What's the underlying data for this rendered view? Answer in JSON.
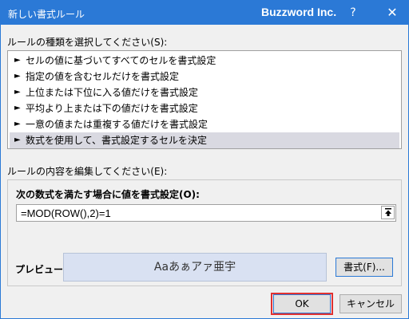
{
  "window": {
    "title": "新しい書式ルール",
    "brand": "Buzzword Inc.",
    "help_label": "?",
    "close_label": "✕"
  },
  "rule_type": {
    "label": "ルールの種類を選択してください(S):",
    "items": [
      {
        "label": "セルの値に基づいてすべてのセルを書式設定"
      },
      {
        "label": "指定の値を含むセルだけを書式設定"
      },
      {
        "label": "上位または下位に入る値だけを書式設定"
      },
      {
        "label": "平均より上または下の値だけを書式設定"
      },
      {
        "label": "一意の値または重複する値だけを書式設定"
      },
      {
        "label": "数式を使用して、書式設定するセルを決定"
      }
    ],
    "selected_index": 5
  },
  "rule_desc": {
    "label": "ルールの内容を編集してください(E):",
    "formula_label": "次の数式を満たす場合に値を書式設定(O):",
    "formula_value": "=MOD(ROW(),2)=1"
  },
  "preview": {
    "label": "プレビュー:",
    "sample_text": "Aaあぁアァ亜宇"
  },
  "buttons": {
    "format": "書式(F)...",
    "ok": "OK",
    "cancel": "キャンセル"
  },
  "colors": {
    "titlebar": "#2b79d6",
    "highlight_border": "#e03131",
    "preview_bg": "#d9e1f2"
  }
}
